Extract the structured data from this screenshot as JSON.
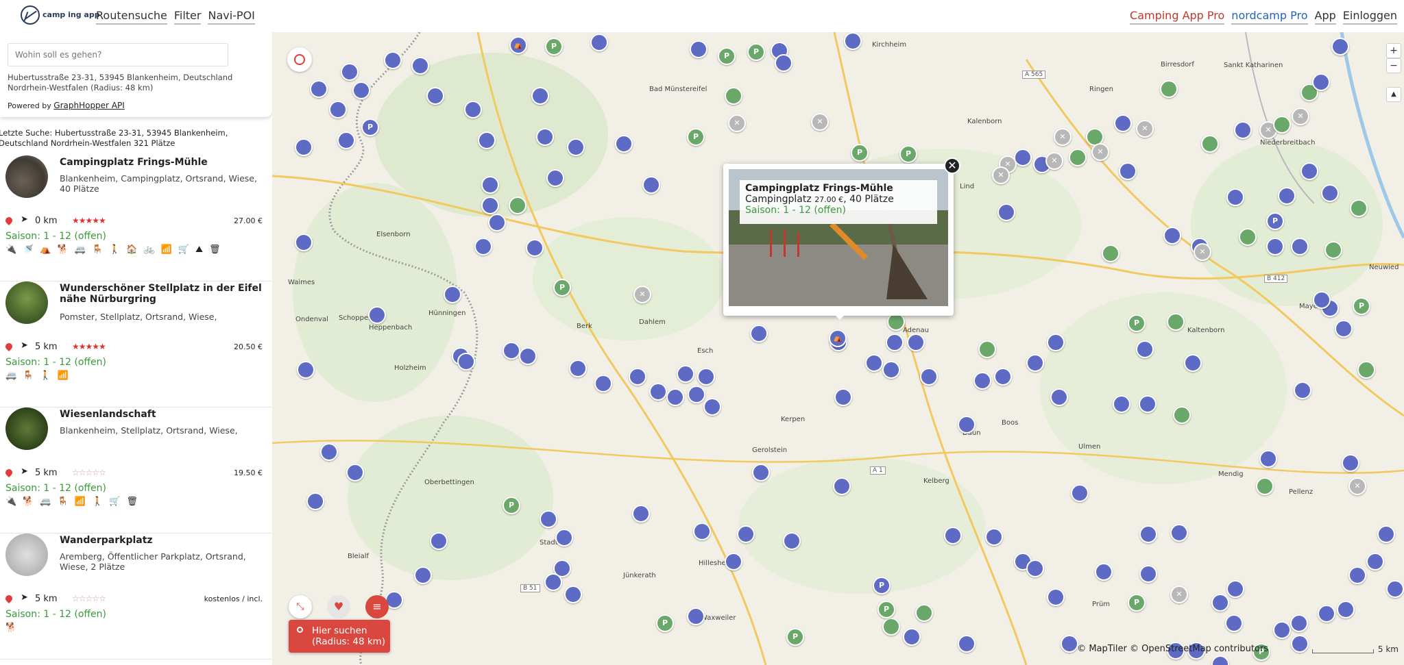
{
  "header": {
    "logo_text": "camp ing app",
    "nav_left": [
      "Routensuche",
      "Filter",
      "Navi-POI"
    ],
    "nav_right": [
      "Camping App Pro",
      "nordcamp Pro",
      "App",
      "Einloggen"
    ]
  },
  "search": {
    "placeholder": "Wohin soll es gehen?",
    "address": "Hubertusstraße 23-31, 53945 Blankenheim, Deutschland Nordrhein-Westfalen (Radius: 48 km)",
    "powered_prefix": "Powered by",
    "powered_link": "GraphHopper API"
  },
  "last_search": "Letzte Suche: Hubertusstraße 23-31, 53945 Blankenheim, Deutschland Nordrhein-Westfalen 321 Plätze",
  "items": [
    {
      "title": "Campingplatz Frings-Mühle",
      "desc": "Blankenheim, Campingplatz, Ortsrand, Wiese, 40 Plätze",
      "distance": "0 km",
      "stars": "★★★★★",
      "price": "27.00 €",
      "season": "Saison: 1 -  12 (offen)",
      "amenities": [
        "🔌",
        "🚿",
        "⛺",
        "🐕",
        "🚐",
        "🪑",
        "🚶",
        "🏠",
        "🚲",
        "📶",
        "🛒",
        "⛰",
        "🗑"
      ]
    },
    {
      "title": "Wunderschöner Stellplatz in der Eifel nähe Nürburgring",
      "desc": "Pomster, Stellplatz, Ortsrand, Wiese,",
      "distance": "5 km",
      "stars": "★★★★★",
      "price": "20.50 €",
      "season": "Saison: 1 -  12 (offen)",
      "amenities": [
        "🚐",
        "🪑",
        "🚶",
        "📶"
      ]
    },
    {
      "title": "Wiesenlandschaft",
      "desc": "Blankenheim, Stellplatz, Ortsrand, Wiese,",
      "distance": "5 km",
      "stars": "☆☆☆☆☆",
      "price": "19.50 €",
      "season": "Saison: 1 -  12 (offen)",
      "amenities": [
        "🔌",
        "🐕",
        "🚐",
        "🪑",
        "📶",
        "🚶",
        "🛒",
        "🗑"
      ]
    },
    {
      "title": "Wanderparkplatz",
      "desc": "Aremberg, Öffentlicher Parkplatz, Ortsrand, Wiese, 2 Plätze",
      "distance": "5 km",
      "stars": "☆☆☆☆☆",
      "price": "kostenlos / incl.",
      "season": "Saison: 1 -  12 (offen)",
      "amenities": [
        "🐕"
      ]
    }
  ],
  "popup": {
    "title": "Campingplatz Frings-Mühle",
    "type": "Campingplatz",
    "price": "27.00 €",
    "places": ", 40 Plätze",
    "season": "Saison: 1 -  12 (offen)"
  },
  "map": {
    "search_button": "Hier suchen (Radius: 48 km)",
    "attribution": "© MapTiler © OpenStreetMap contributors",
    "scale": "5 km",
    "zoom_in": "+",
    "zoom_out": "−",
    "compass": "▲",
    "road_labels": [
      "A 565",
      "B 412",
      "A 1",
      "B 51"
    ],
    "places": [
      "Kirchheim",
      "Bad Münstereifel",
      "Ringen",
      "Birresdorf",
      "Sankt Katharinen",
      "Kalenborn",
      "Niederbreitbach",
      "Lind",
      "Elsenborn",
      "Waimes",
      "Ondenval",
      "Schoppen",
      "Hünningen",
      "Heppenbach",
      "Holzheim",
      "Dahlem",
      "Berk",
      "Esch",
      "Adenau",
      "Kaltenborn",
      "Neuwied",
      "Mayen",
      "Kerpen",
      "Gerolstein",
      "Daun",
      "Ulmen",
      "Kelberg",
      "Mendig",
      "Pellenz",
      "Stadtkyll",
      "Jünkerath",
      "Hillesheim",
      "Boos",
      "Oberbettingen",
      "Prüm",
      "Bleialf",
      "Waxweiler"
    ]
  },
  "colors": {
    "accent_red": "#d9473f",
    "marker_blue": "#5d6bc4",
    "marker_green": "#6aa86a",
    "season_green": "#3a9a3a",
    "nav_blue": "#2563c4",
    "nav_red": "#c0392b"
  }
}
